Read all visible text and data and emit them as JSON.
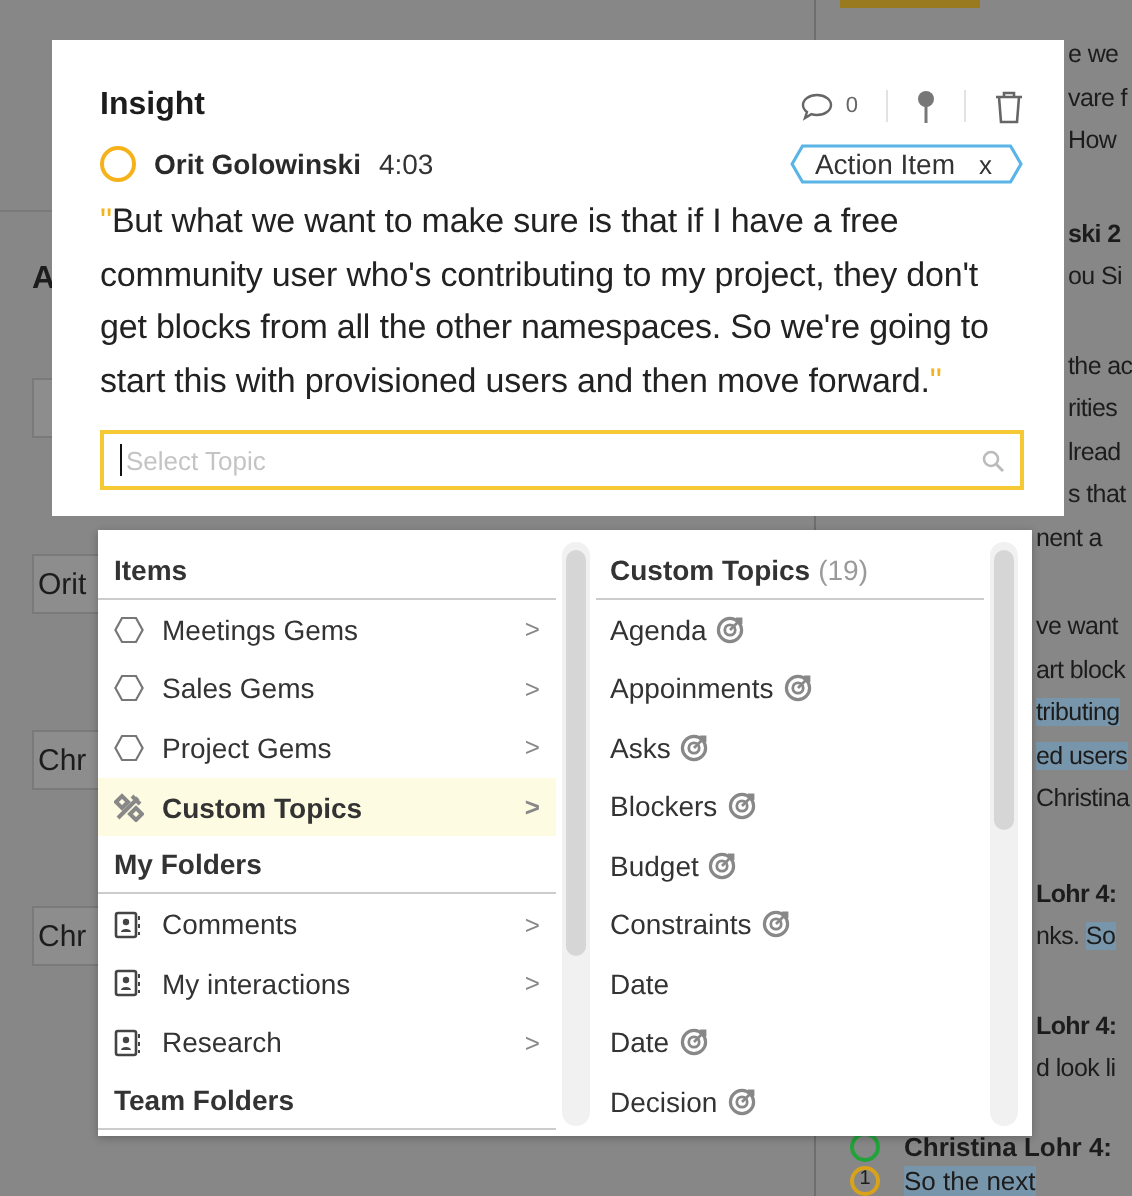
{
  "background": {
    "left_fragments": [
      {
        "kind": "heading",
        "text": "A"
      },
      {
        "kind": "empty_box"
      },
      {
        "kind": "box",
        "text": "Orit"
      },
      {
        "kind": "box",
        "text": "Chr"
      },
      {
        "kind": "box",
        "text": "Chr"
      }
    ],
    "transcript_fragments": [
      {
        "lines": [
          {
            "bold": false,
            "parts": [
              {
                "text": "e we",
                "highlighted": false
              }
            ]
          },
          {
            "bold": false,
            "parts": [
              {
                "text": "vare f",
                "highlighted": false
              }
            ]
          },
          {
            "bold": false,
            "parts": [
              {
                "text": "How",
                "highlighted": false
              }
            ]
          }
        ]
      },
      {
        "lines": [
          {
            "bold": true,
            "parts": [
              {
                "text": "ski  2",
                "highlighted": false
              }
            ]
          },
          {
            "bold": false,
            "parts": [
              {
                "text": "ou Si",
                "highlighted": false
              }
            ]
          }
        ]
      },
      {
        "lines": [
          {
            "bold": false,
            "parts": [
              {
                "text": "the ac",
                "highlighted": false
              }
            ]
          },
          {
            "bold": false,
            "parts": [
              {
                "text": "rities",
                "highlighted": false
              }
            ]
          },
          {
            "bold": false,
            "parts": [
              {
                "text": "lread",
                "highlighted": false
              }
            ]
          },
          {
            "bold": false,
            "parts": [
              {
                "text": "s that",
                "highlighted": false
              }
            ]
          }
        ]
      },
      {
        "lines": [
          {
            "bold": false,
            "parts": [
              {
                "text": "nent a",
                "highlighted": false
              }
            ]
          }
        ]
      },
      {
        "lines": [
          {
            "bold": false,
            "parts": [
              {
                "text": "ve want",
                "highlighted": false
              }
            ]
          },
          {
            "bold": false,
            "parts": [
              {
                "text": "art block",
                "highlighted": false
              }
            ]
          },
          {
            "bold": false,
            "parts": [
              {
                "text": "tributing",
                "highlighted": true
              }
            ]
          },
          {
            "bold": false,
            "parts": [
              {
                "text": "ed users",
                "highlighted": true
              }
            ]
          },
          {
            "bold": false,
            "parts": [
              {
                "text": "Christina",
                "highlighted": false
              }
            ]
          }
        ]
      },
      {
        "lines": [
          {
            "bold": true,
            "parts": [
              {
                "text": "Lohr  4:",
                "highlighted": false
              }
            ]
          },
          {
            "bold": false,
            "parts": [
              {
                "text": "nks. ",
                "highlighted": false
              },
              {
                "text": "So",
                "highlighted": true
              }
            ]
          }
        ]
      },
      {
        "lines": [
          {
            "bold": true,
            "parts": [
              {
                "text": "Lohr  4:",
                "highlighted": false
              }
            ]
          },
          {
            "bold": false,
            "parts": [
              {
                "text": "d look li",
                "highlighted": false
              }
            ]
          }
        ]
      }
    ],
    "transcript_bottom": [
      {
        "kind": "avatar",
        "color": "#22a33a",
        "text": "Christina Lohr  4:",
        "bold": true,
        "highlighted": false
      },
      {
        "kind": "badge",
        "badge": "1",
        "color": "#d9a21b",
        "text": "So the next",
        "bold": false,
        "highlighted": true
      }
    ]
  },
  "modal": {
    "title": "Insight",
    "comment_count": "0",
    "speaker": {
      "name": "Orit Golowinski",
      "time": "4:03"
    },
    "tag": {
      "label": "Action Item",
      "close": "x"
    },
    "open_quote": "\"",
    "quote": "But what we want to make sure is that if I have a free community user who's contributing to my project, they don't get blocks from all the other namespaces. So we're going to start this with provisioned users and then move forward.",
    "close_quote": "\"",
    "search": {
      "placeholder": "Select Topic"
    }
  },
  "dropdown": {
    "sections": [
      {
        "title": "Items",
        "items": [
          {
            "label": "Meetings Gems",
            "kind": "gem",
            "chevron": ">",
            "selected": false
          },
          {
            "label": "Sales Gems",
            "kind": "gem",
            "chevron": ">",
            "selected": false
          },
          {
            "label": "Project Gems",
            "kind": "gem",
            "chevron": ">",
            "selected": false
          },
          {
            "label": "Custom Topics",
            "kind": "tools",
            "chevron": ">",
            "selected": true
          }
        ]
      },
      {
        "title": "My Folders",
        "items": [
          {
            "label": "Comments",
            "kind": "folder",
            "chevron": ">",
            "selected": false
          },
          {
            "label": "My interactions",
            "kind": "folder",
            "chevron": ">",
            "selected": false
          },
          {
            "label": "Research",
            "kind": "folder",
            "chevron": ">",
            "selected": false
          }
        ]
      },
      {
        "title": "Team Folders"
      }
    ],
    "topics": {
      "title": "Custom Topics",
      "count": "(19)",
      "items": [
        {
          "label": "Agenda",
          "tracked": true
        },
        {
          "label": "Appoinments",
          "tracked": true
        },
        {
          "label": "Asks",
          "tracked": true
        },
        {
          "label": "Blockers",
          "tracked": true
        },
        {
          "label": "Budget",
          "tracked": true
        },
        {
          "label": "Constraints",
          "tracked": true
        },
        {
          "label": "Date",
          "tracked": false
        },
        {
          "label": "Date",
          "tracked": true
        },
        {
          "label": "Decision",
          "tracked": true
        }
      ]
    }
  }
}
